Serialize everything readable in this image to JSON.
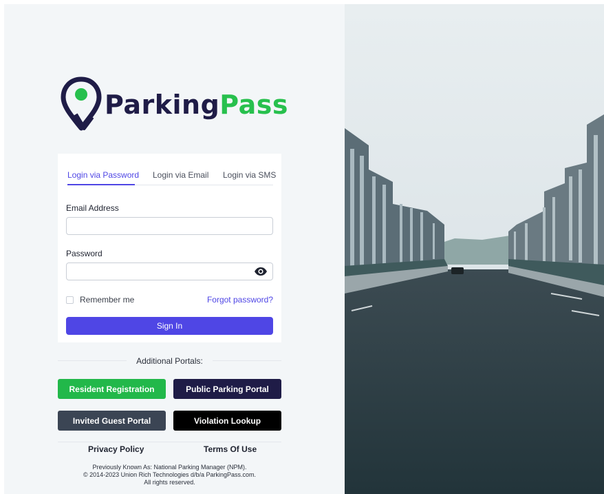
{
  "brand": {
    "name_part1": "Parking",
    "name_part2": "Pass",
    "primary_color": "#1f1c47",
    "accent_color": "#27c04d"
  },
  "login": {
    "tabs": [
      {
        "label": "Login via Password",
        "active": true
      },
      {
        "label": "Login via Email",
        "active": false
      },
      {
        "label": "Login via SMS",
        "active": false
      }
    ],
    "email_label": "Email Address",
    "email_value": "",
    "password_label": "Password",
    "password_value": "",
    "show_password_icon": "eye-icon",
    "remember_label": "Remember me",
    "remember_checked": false,
    "forgot_label": "Forgot password?",
    "signin_label": "Sign In",
    "signin_color": "#4f46e5"
  },
  "portals": {
    "heading": "Additional Portals:",
    "buttons": [
      {
        "label": "Resident Registration",
        "color": "#22b84a"
      },
      {
        "label": "Public Parking Portal",
        "color": "#1f1c47"
      },
      {
        "label": "Invited Guest Portal",
        "color": "#3b4554"
      },
      {
        "label": "Violation Lookup",
        "color": "#000000"
      }
    ]
  },
  "footer": {
    "privacy_label": "Privacy Policy",
    "terms_label": "Terms Of Use",
    "legal_line1": "Previously Known As: National Parking Manager (NPM).",
    "legal_line2": "© 2014-2023 Union Rich Technologies d/b/a ParkingPass.com.",
    "legal_line3": "All rights reserved."
  }
}
